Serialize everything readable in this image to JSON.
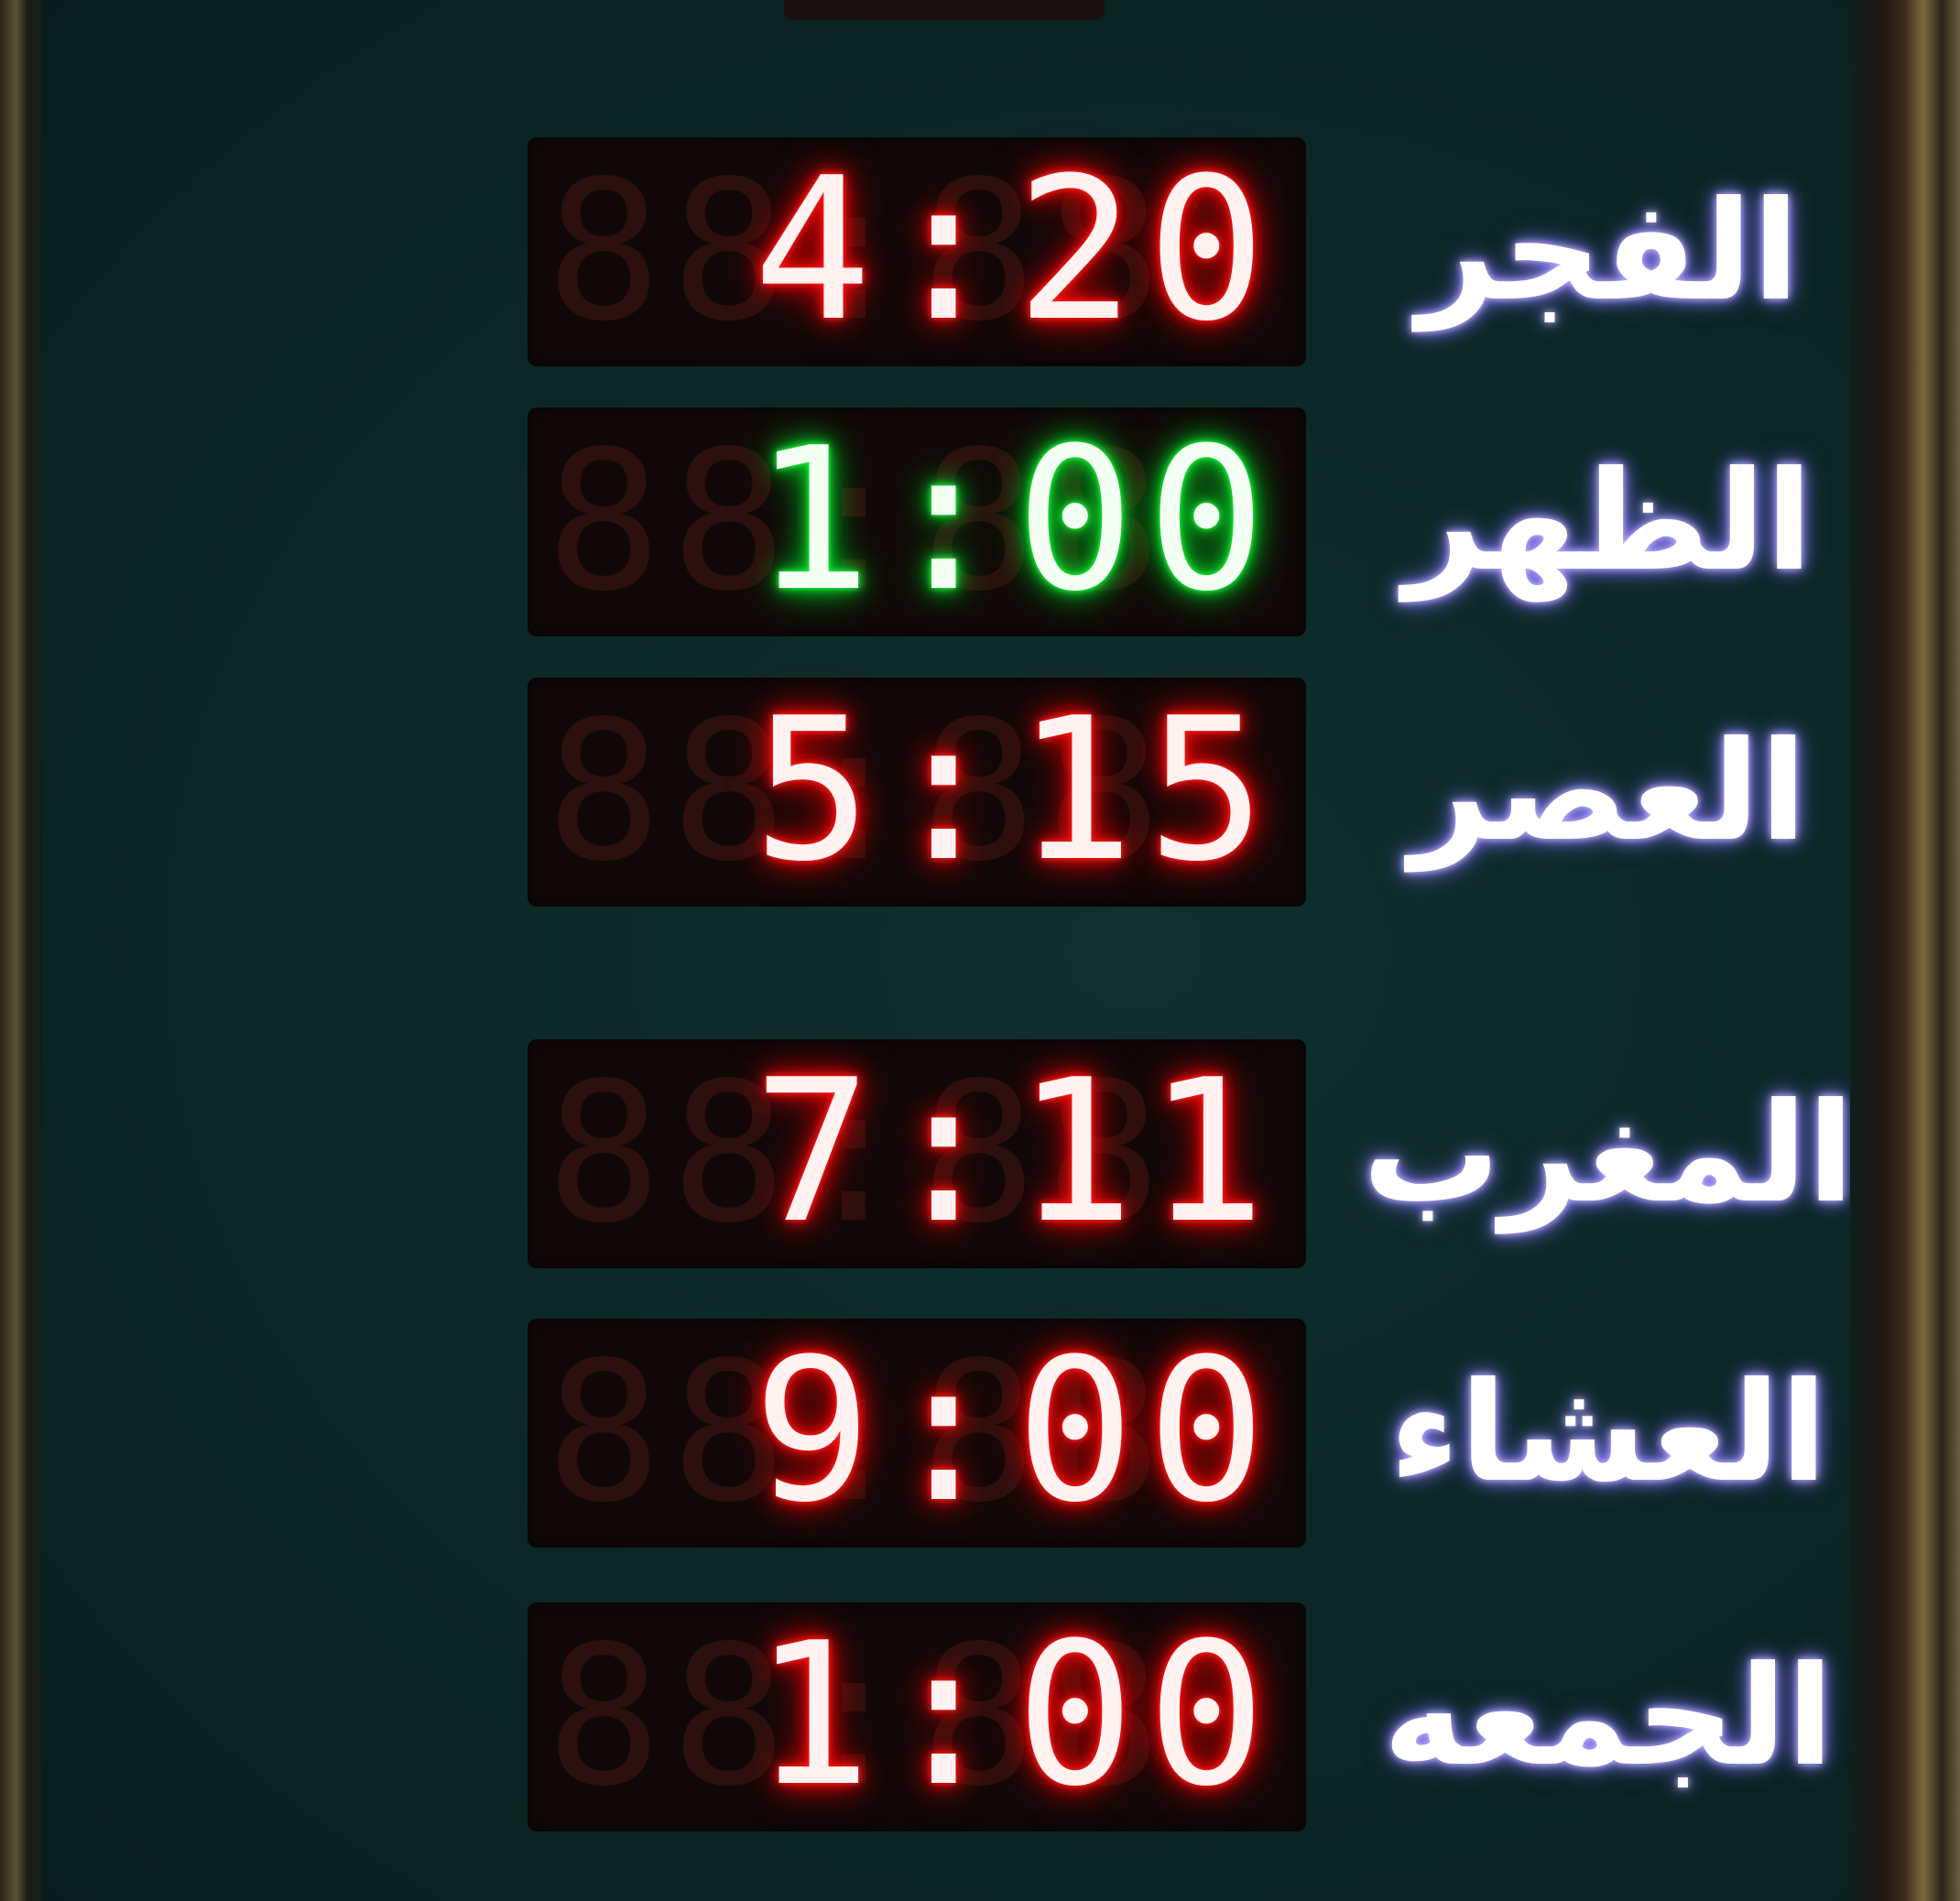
{
  "board": {
    "rows": [
      {
        "name": "الفجر",
        "time": "4:20",
        "color": "red"
      },
      {
        "name": "الظهر",
        "time": "1:00",
        "color": "green"
      },
      {
        "name": "العصر",
        "time": "5:15",
        "color": "red"
      },
      {
        "name": "المغرب",
        "time": "7:11",
        "color": "red"
      },
      {
        "name": "العشاء",
        "time": "9:00",
        "color": "red"
      },
      {
        "name": "الجمعه",
        "time": "1:00",
        "color": "red"
      }
    ]
  },
  "colors": {
    "led_red": "#ff1a1a",
    "led_green": "#19e63a",
    "panel_bg": "#0b2624",
    "label_text": "#ffffff"
  }
}
